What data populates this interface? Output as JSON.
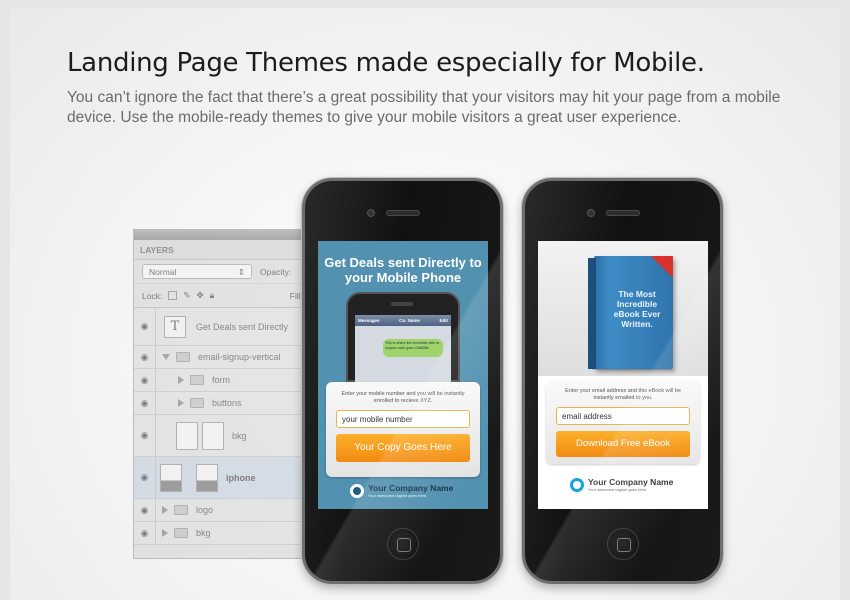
{
  "header": {
    "title": "Landing Page Themes made especially for Mobile.",
    "description": "You can’t ignore the fact that there’s a great possibility that your visitors may hit your page from a mobile device. Use the mobile-ready themes to give your mobile visitors a great user experience."
  },
  "layers_panel": {
    "tab": "LAYERS",
    "blend_mode": "Normal",
    "opacity_label": "Opacity:",
    "lock_label": "Lock:",
    "fill_label": "Fill:",
    "layers": [
      {
        "name": "Get Deals sent Directly",
        "type": "text"
      },
      {
        "name": "email-signup-vertical",
        "type": "folder-open"
      },
      {
        "name": "form",
        "type": "folder"
      },
      {
        "name": "buttons",
        "type": "folder"
      },
      {
        "name": "bkg",
        "type": "layer"
      },
      {
        "name": "iphone",
        "type": "layer",
        "selected": true
      },
      {
        "name": "logo",
        "type": "folder"
      },
      {
        "name": "bkg",
        "type": "folder"
      }
    ]
  },
  "phone1": {
    "headline": "Get Deals sent Directly to your Mobile Phone",
    "mini_back": "Messages",
    "mini_title": "Co. Name",
    "mini_edit": "Edit",
    "mini_message": "This is where the incredible offer or coupon code goes CMABBu",
    "form_text": "Enter your mobile number and you will be instantly enrolled to recieve XYZ.",
    "input_value": "your mobile number",
    "button_label": "Your Copy Goes Here",
    "company_name": "Your Company Name",
    "company_tagline": "Your awesome tagline goes here."
  },
  "phone2": {
    "book_title": "The Most Incredible eBook Ever Written.",
    "form_text": "Enter your email address and this eBook will be instantly emailed to you.",
    "input_value": "email address",
    "button_label": "Download Free eBook",
    "company_name": "Your Company Name",
    "company_tagline": "Your awesome tagline goes here."
  },
  "colors": {
    "accent_orange": "#f38a13",
    "phone1_screen": "#5291b0",
    "logo_blue": "#1aa3d9"
  }
}
